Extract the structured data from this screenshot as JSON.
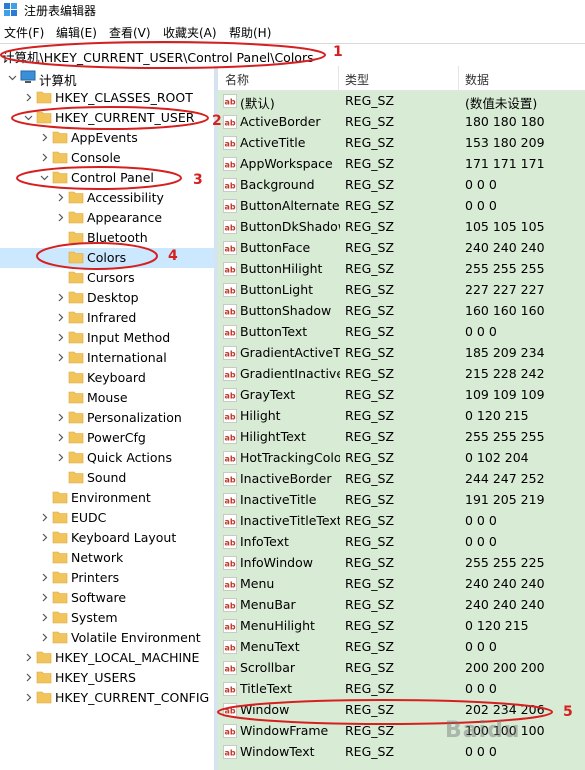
{
  "window": {
    "title": "注册表编辑器",
    "icon": "regedit-icon"
  },
  "menu": [
    "文件(F)",
    "编辑(E)",
    "查看(V)",
    "收藏夹(A)",
    "帮助(H)"
  ],
  "address": {
    "path": "计算机\\HKEY_CURRENT_USER\\Control Panel\\Colors"
  },
  "tree": [
    {
      "label": "计算机",
      "level": 0,
      "expander": "open",
      "icon": "computer-icon"
    },
    {
      "label": "HKEY_CLASSES_ROOT",
      "level": 1,
      "expander": "closed",
      "icon": "folder-icon"
    },
    {
      "label": "HKEY_CURRENT_USER",
      "level": 1,
      "expander": "open",
      "icon": "folder-icon"
    },
    {
      "label": "AppEvents",
      "level": 2,
      "expander": "closed",
      "icon": "folder-icon"
    },
    {
      "label": "Console",
      "level": 2,
      "expander": "closed",
      "icon": "folder-icon"
    },
    {
      "label": "Control Panel",
      "level": 2,
      "expander": "open",
      "icon": "folder-icon"
    },
    {
      "label": "Accessibility",
      "level": 3,
      "expander": "closed",
      "icon": "folder-icon"
    },
    {
      "label": "Appearance",
      "level": 3,
      "expander": "closed",
      "icon": "folder-icon"
    },
    {
      "label": "Bluetooth",
      "level": 3,
      "expander": "none",
      "icon": "folder-icon"
    },
    {
      "label": "Colors",
      "level": 3,
      "expander": "none",
      "icon": "folder-icon",
      "selected": true
    },
    {
      "label": "Cursors",
      "level": 3,
      "expander": "none",
      "icon": "folder-icon"
    },
    {
      "label": "Desktop",
      "level": 3,
      "expander": "closed",
      "icon": "folder-icon"
    },
    {
      "label": "Infrared",
      "level": 3,
      "expander": "closed",
      "icon": "folder-icon"
    },
    {
      "label": "Input Method",
      "level": 3,
      "expander": "closed",
      "icon": "folder-icon"
    },
    {
      "label": "International",
      "level": 3,
      "expander": "closed",
      "icon": "folder-icon"
    },
    {
      "label": "Keyboard",
      "level": 3,
      "expander": "none",
      "icon": "folder-icon"
    },
    {
      "label": "Mouse",
      "level": 3,
      "expander": "none",
      "icon": "folder-icon"
    },
    {
      "label": "Personalization",
      "level": 3,
      "expander": "closed",
      "icon": "folder-icon"
    },
    {
      "label": "PowerCfg",
      "level": 3,
      "expander": "closed",
      "icon": "folder-icon"
    },
    {
      "label": "Quick Actions",
      "level": 3,
      "expander": "closed",
      "icon": "folder-icon"
    },
    {
      "label": "Sound",
      "level": 3,
      "expander": "none",
      "icon": "folder-icon"
    },
    {
      "label": "Environment",
      "level": 2,
      "expander": "none",
      "icon": "folder-icon"
    },
    {
      "label": "EUDC",
      "level": 2,
      "expander": "closed",
      "icon": "folder-icon"
    },
    {
      "label": "Keyboard Layout",
      "level": 2,
      "expander": "closed",
      "icon": "folder-icon"
    },
    {
      "label": "Network",
      "level": 2,
      "expander": "none",
      "icon": "folder-icon"
    },
    {
      "label": "Printers",
      "level": 2,
      "expander": "closed",
      "icon": "folder-icon"
    },
    {
      "label": "Software",
      "level": 2,
      "expander": "closed",
      "icon": "folder-icon"
    },
    {
      "label": "System",
      "level": 2,
      "expander": "closed",
      "icon": "folder-icon"
    },
    {
      "label": "Volatile Environment",
      "level": 2,
      "expander": "closed",
      "icon": "folder-icon"
    },
    {
      "label": "HKEY_LOCAL_MACHINE",
      "level": 1,
      "expander": "closed",
      "icon": "folder-icon"
    },
    {
      "label": "HKEY_USERS",
      "level": 1,
      "expander": "closed",
      "icon": "folder-icon"
    },
    {
      "label": "HKEY_CURRENT_CONFIG",
      "level": 1,
      "expander": "closed",
      "icon": "folder-icon"
    }
  ],
  "columns": {
    "name": "名称",
    "type": "类型",
    "data": "数据"
  },
  "values": [
    {
      "name": "(默认)",
      "type": "REG_SZ",
      "data": "(数值未设置)"
    },
    {
      "name": "ActiveBorder",
      "type": "REG_SZ",
      "data": "180 180 180"
    },
    {
      "name": "ActiveTitle",
      "type": "REG_SZ",
      "data": "153 180 209"
    },
    {
      "name": "AppWorkspace",
      "type": "REG_SZ",
      "data": "171 171 171"
    },
    {
      "name": "Background",
      "type": "REG_SZ",
      "data": "0 0 0"
    },
    {
      "name": "ButtonAlternateFace",
      "type": "REG_SZ",
      "data": "0 0 0"
    },
    {
      "name": "ButtonDkShadow",
      "type": "REG_SZ",
      "data": "105 105 105"
    },
    {
      "name": "ButtonFace",
      "type": "REG_SZ",
      "data": "240 240 240"
    },
    {
      "name": "ButtonHilight",
      "type": "REG_SZ",
      "data": "255 255 255"
    },
    {
      "name": "ButtonLight",
      "type": "REG_SZ",
      "data": "227 227 227"
    },
    {
      "name": "ButtonShadow",
      "type": "REG_SZ",
      "data": "160 160 160"
    },
    {
      "name": "ButtonText",
      "type": "REG_SZ",
      "data": "0 0 0"
    },
    {
      "name": "GradientActiveTitle",
      "type": "REG_SZ",
      "data": "185 209 234"
    },
    {
      "name": "GradientInactiveTitle",
      "type": "REG_SZ",
      "data": "215 228 242"
    },
    {
      "name": "GrayText",
      "type": "REG_SZ",
      "data": "109 109 109"
    },
    {
      "name": "Hilight",
      "type": "REG_SZ",
      "data": "0 120 215"
    },
    {
      "name": "HilightText",
      "type": "REG_SZ",
      "data": "255 255 255"
    },
    {
      "name": "HotTrackingColor",
      "type": "REG_SZ",
      "data": "0 102 204"
    },
    {
      "name": "InactiveBorder",
      "type": "REG_SZ",
      "data": "244 247 252"
    },
    {
      "name": "InactiveTitle",
      "type": "REG_SZ",
      "data": "191 205 219"
    },
    {
      "name": "InactiveTitleText",
      "type": "REG_SZ",
      "data": "0 0 0"
    },
    {
      "name": "InfoText",
      "type": "REG_SZ",
      "data": "0 0 0"
    },
    {
      "name": "InfoWindow",
      "type": "REG_SZ",
      "data": "255 255 225"
    },
    {
      "name": "Menu",
      "type": "REG_SZ",
      "data": "240 240 240"
    },
    {
      "name": "MenuBar",
      "type": "REG_SZ",
      "data": "240 240 240"
    },
    {
      "name": "MenuHilight",
      "type": "REG_SZ",
      "data": "0 120 215"
    },
    {
      "name": "MenuText",
      "type": "REG_SZ",
      "data": "0 0 0"
    },
    {
      "name": "Scrollbar",
      "type": "REG_SZ",
      "data": "200 200 200"
    },
    {
      "name": "TitleText",
      "type": "REG_SZ",
      "data": "0 0 0"
    },
    {
      "name": "Window",
      "type": "REG_SZ",
      "data": "202 234 206"
    },
    {
      "name": "WindowFrame",
      "type": "REG_SZ",
      "data": "100 100 100"
    },
    {
      "name": "WindowText",
      "type": "REG_SZ",
      "data": "0 0 0"
    }
  ],
  "annotations": [
    "1",
    "2",
    "3",
    "4",
    "5"
  ],
  "watermark": "Baidu",
  "colors": {
    "values_bg": "#d8ebd5",
    "annotation": "#d62020",
    "folder": "#f2c55c",
    "selection": "#cce8ff"
  }
}
